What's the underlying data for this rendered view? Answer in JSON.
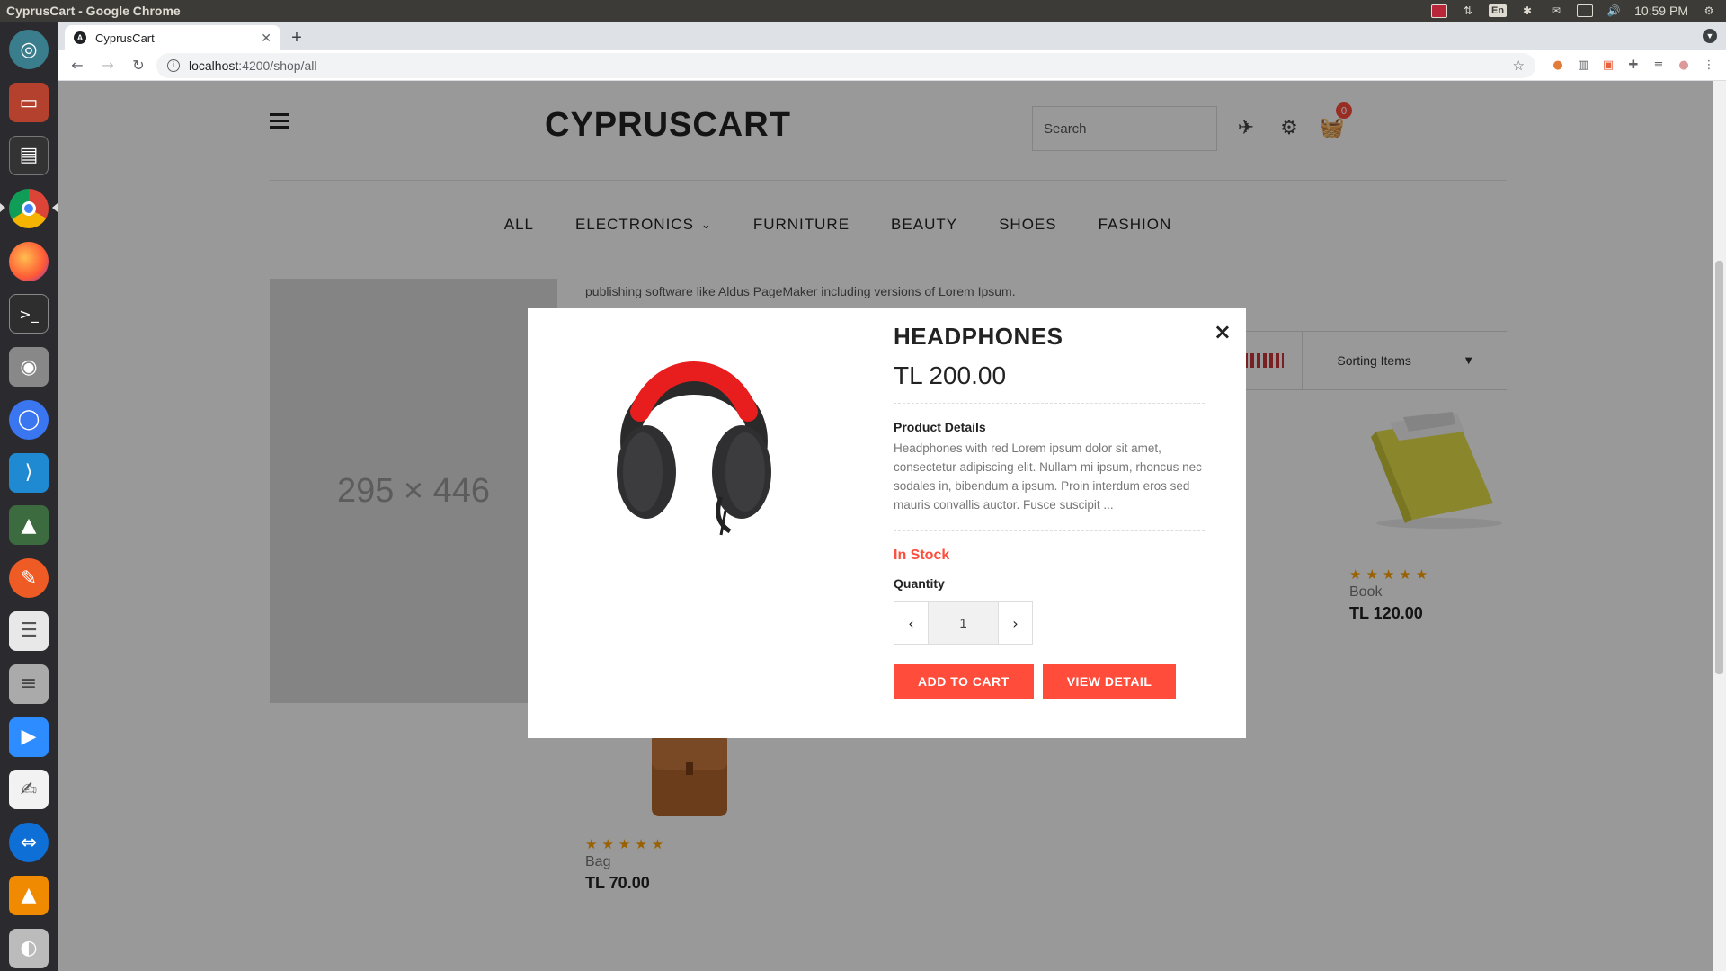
{
  "os": {
    "window_title": "CyprusCart - Google Chrome",
    "lang": "En",
    "time": "10:59 PM"
  },
  "launcher": [
    "ubuntu-dash-icon",
    "files-icon",
    "terminal-icon",
    "chrome-icon",
    "firefox-icon",
    "terminal-icon",
    "camera-icon",
    "signal-icon",
    "vscode-icon",
    "robo3t-icon",
    "postman-icon",
    "text-editor-icon",
    "database-icon",
    "zoom-icon",
    "gedit-icon",
    "teamviewer-icon",
    "vlc-icon",
    "disks-icon"
  ],
  "browser": {
    "tab_title": "CyprusCart",
    "url_host": "localhost",
    "url_path": ":4200/shop/all"
  },
  "site": {
    "brand": "CYPRUSCART",
    "search_placeholder": "Search",
    "cart_count": "0",
    "nav": [
      "ALL",
      "ELECTRONICS",
      "FURNITURE",
      "BEAUTY",
      "SHOES",
      "FASHION"
    ]
  },
  "listing": {
    "placeholder_label": "295 × 446",
    "description_snippet": "publishing software like Aldus PageMaker including versions of Lorem Ipsum.",
    "sort_label": "Sorting Items",
    "products": [
      {
        "name": "Book",
        "price": "TL 120.00",
        "stars": "★★★★★",
        "rating": 5
      },
      {
        "name": "Bag",
        "price": "TL 70.00",
        "stars": "★★★★★",
        "rating": 5
      }
    ]
  },
  "modal": {
    "title": "HEADPHONES",
    "price": "TL 200.00",
    "details_heading": "Product Details",
    "details_text": "Headphones with red Lorem ipsum dolor sit amet, consectetur adipiscing elit. Nullam mi ipsum, rhoncus nec sodales in, bibendum a ipsum. Proin interdum eros sed mauris convallis auctor. Fusce suscipit ...",
    "stock": "In Stock",
    "quantity_label": "Quantity",
    "quantity": "1",
    "add_to_cart": "ADD TO CART",
    "view_detail": "VIEW DETAIL",
    "close": "×"
  },
  "colors": {
    "accent": "#ff4c3b",
    "star": "#ffa200",
    "os_bar": "#3c3b37",
    "launcher": "#2b2a2f"
  }
}
